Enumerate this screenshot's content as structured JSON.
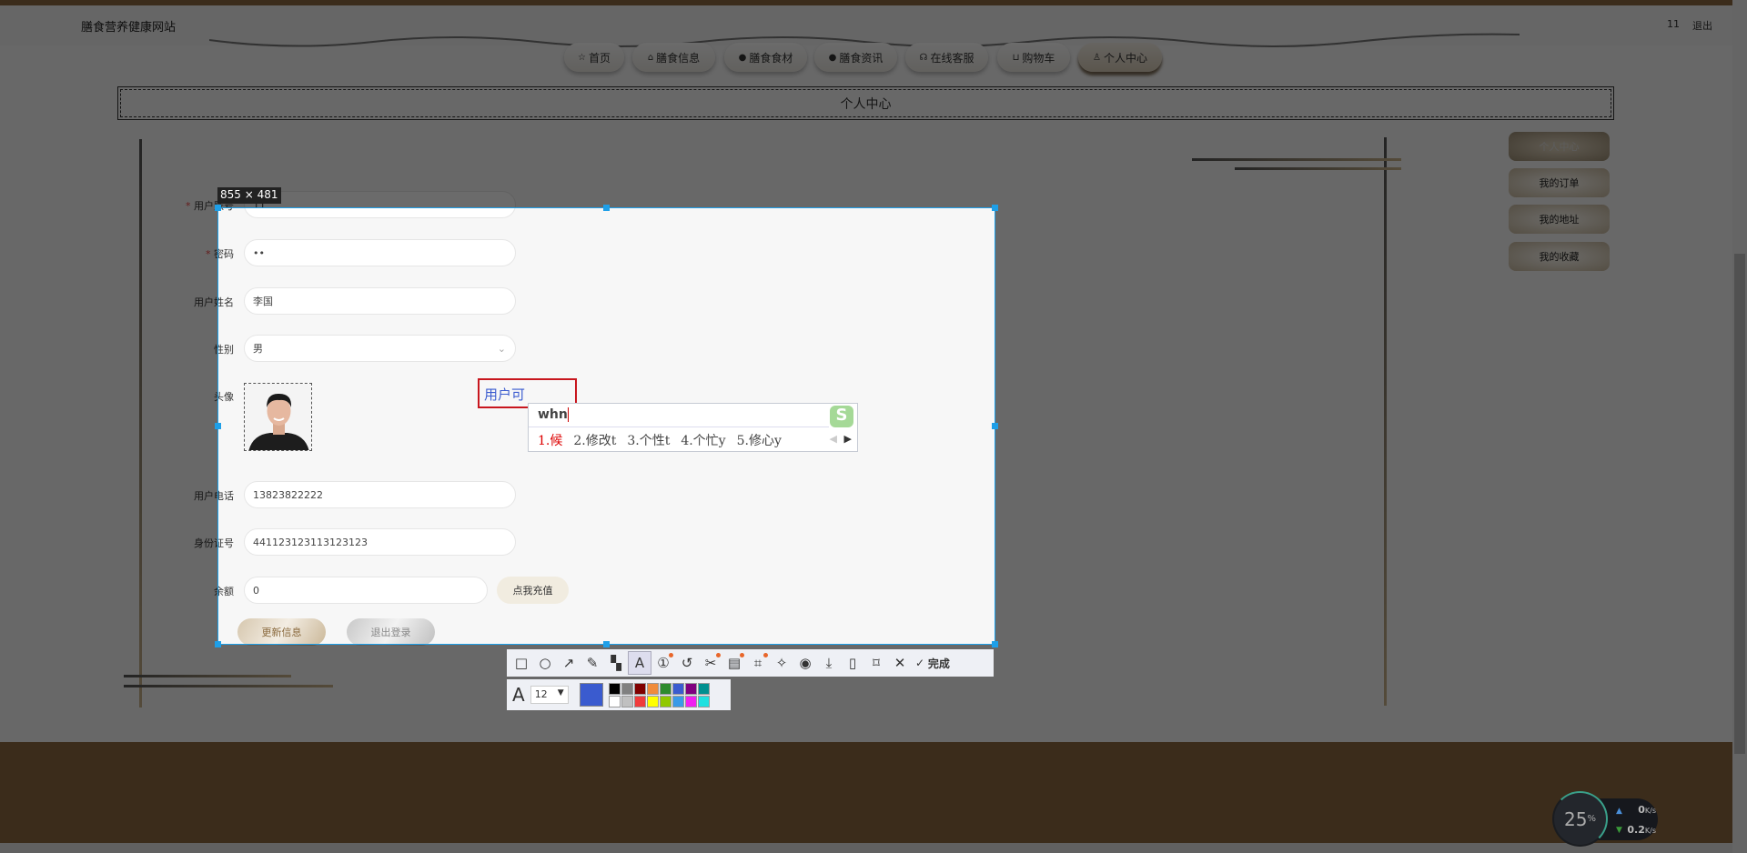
{
  "header": {
    "site_title": "膳食营养健康网站",
    "user_id": "11",
    "logout": "退出"
  },
  "nav": [
    {
      "label": "首页",
      "icon": "☆"
    },
    {
      "label": "膳食信息",
      "icon": "⌂"
    },
    {
      "label": "膳食食材",
      "icon": "●"
    },
    {
      "label": "膳食资讯",
      "icon": "●"
    },
    {
      "label": "在线客服",
      "icon": "☊"
    },
    {
      "label": "购物车",
      "icon": "⊔"
    },
    {
      "label": "个人中心",
      "icon": "♙",
      "active": true
    }
  ],
  "page_title": "个人中心",
  "sidebar": [
    "个人中心",
    "我的订单",
    "我的地址",
    "我的收藏"
  ],
  "form": {
    "account": {
      "label": "用户账号",
      "value": "11"
    },
    "password": {
      "label": "密码",
      "value": "••"
    },
    "name": {
      "label": "用户姓名",
      "value": "李国"
    },
    "gender": {
      "label": "性别",
      "value": "男"
    },
    "avatar": {
      "label": "头像"
    },
    "phone": {
      "label": "用户电话",
      "value": "13823822222"
    },
    "idcard": {
      "label": "身份证号",
      "value": "441123123113123123"
    },
    "balance": {
      "label": "余额",
      "value": "0",
      "recharge": "点我充值"
    },
    "update": "更新信息",
    "logout": "退出登录"
  },
  "capture": {
    "size": "855 × 481",
    "annotation_text": "用户可",
    "text_color": "#3a5bcf",
    "font_size": "12",
    "done": "完成",
    "colors": [
      "#000000",
      "#808080",
      "#800000",
      "#f08c3c",
      "#2e8b2e",
      "#3a5bcf",
      "#800080",
      "#009090",
      "#ffffff",
      "#c0c0c0",
      "#f03c3c",
      "#ffff00",
      "#90c800",
      "#3a9ae8",
      "#f020f0",
      "#20e0e0"
    ]
  },
  "ime": {
    "input": "whn",
    "candidates": [
      "1.候",
      "2.修改t",
      "3.个性t",
      "4.个忙y",
      "5.修心y"
    ]
  },
  "net": {
    "percent": "25",
    "pct_sign": "%",
    "up": "0",
    "down": "0.2",
    "unit": "K/s"
  }
}
